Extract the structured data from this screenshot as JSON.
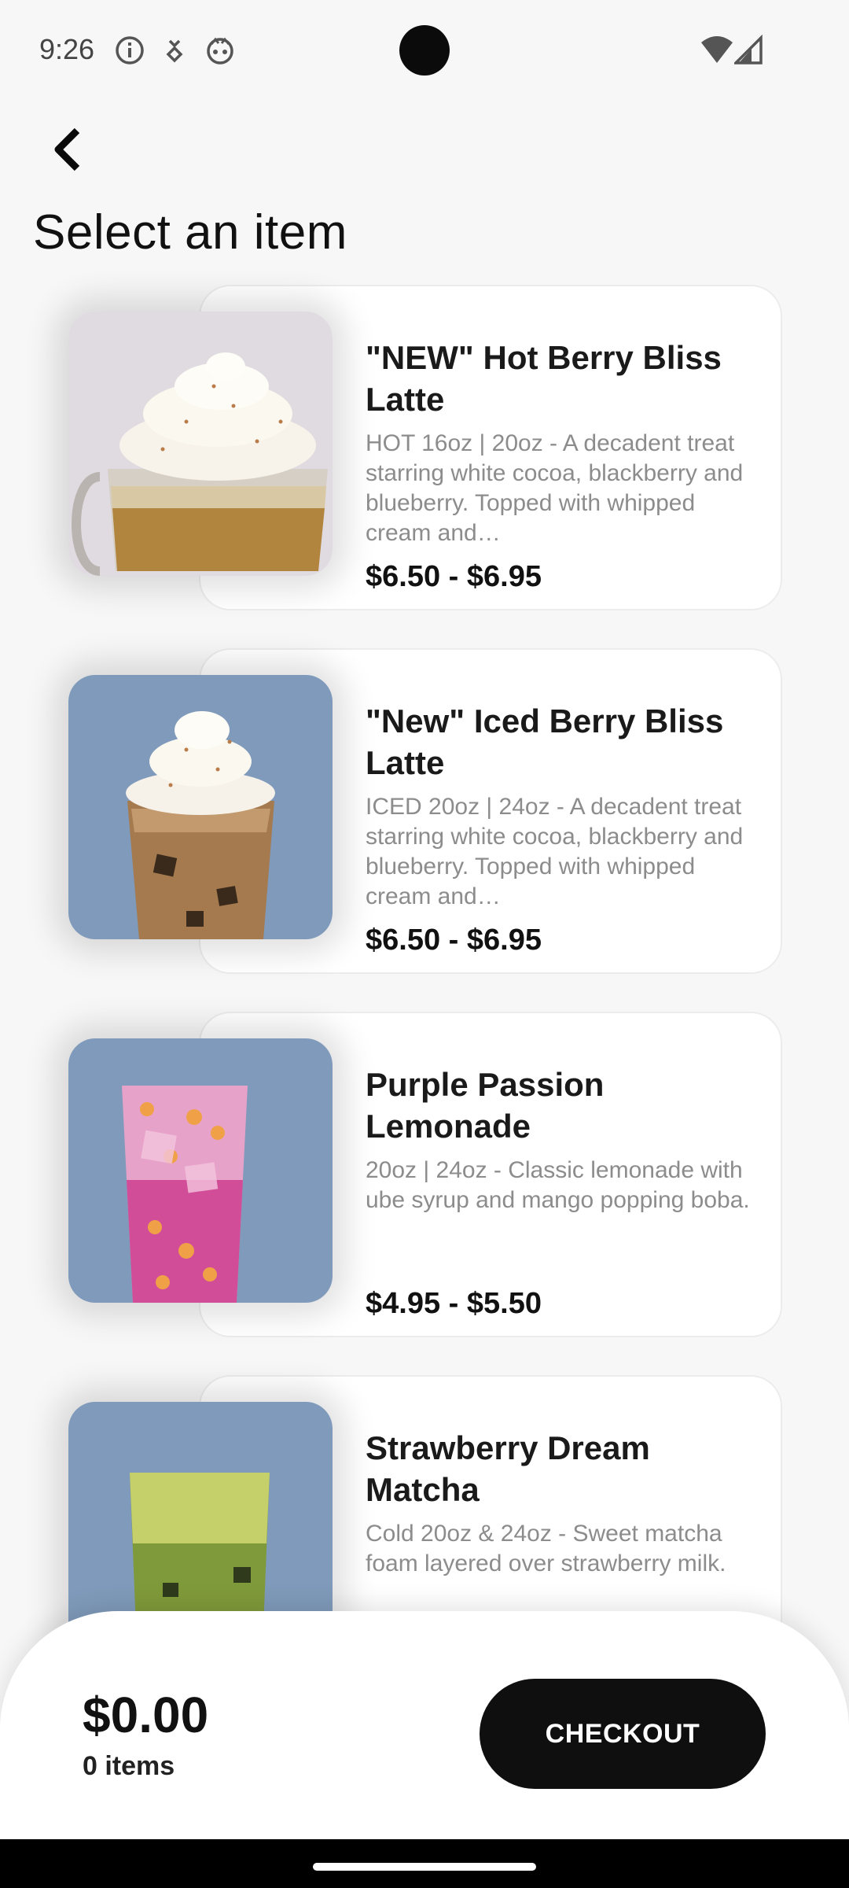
{
  "status": {
    "time": "9:26",
    "icons": [
      "info-icon",
      "download-icon",
      "assistant-face-icon",
      "camera-cutout",
      "wifi-icon",
      "signal-icon"
    ]
  },
  "header": {
    "back_icon": "chevron-left-icon",
    "title": "Select an item"
  },
  "items": [
    {
      "name": "\"NEW\" Hot Berry Bliss Latte",
      "description": "HOT 16oz | 20oz - A decadent treat starring white cocoa, blackberry and blueberry. Topped with whipped cream and…",
      "price": "$6.50 - $6.95",
      "image": "hot-latte-mug-image",
      "image_bg": "#e0dbe0"
    },
    {
      "name": "\"New\" Iced Berry Bliss Latte",
      "description": "ICED 20oz | 24oz - A decadent treat starring white cocoa, blackberry and blueberry. Topped with whipped cream and…",
      "price": "$6.50 - $6.95",
      "image": "iced-latte-cup-image",
      "image_bg": "#7f9aba"
    },
    {
      "name": "Purple Passion Lemonade",
      "description": "20oz | 24oz - Classic  lemonade with ube syrup and mango popping boba.",
      "price": "$4.95 - $5.50",
      "image": "purple-lemonade-cup-image",
      "image_bg": "#7f9aba"
    },
    {
      "name": "Strawberry Dream Matcha",
      "description": "Cold 20oz & 24oz - Sweet matcha foam layered over strawberry milk.",
      "price": "",
      "image": "strawberry-matcha-cup-image",
      "image_bg": "#7f9aba"
    }
  ],
  "cart": {
    "total": "$0.00",
    "count": "0 items",
    "checkout_label": "CHECKOUT"
  },
  "colors": {
    "background": "#f7f7f7",
    "card": "#ffffff",
    "button": "#0f0f0f",
    "muted_text": "#8c8c8c"
  }
}
